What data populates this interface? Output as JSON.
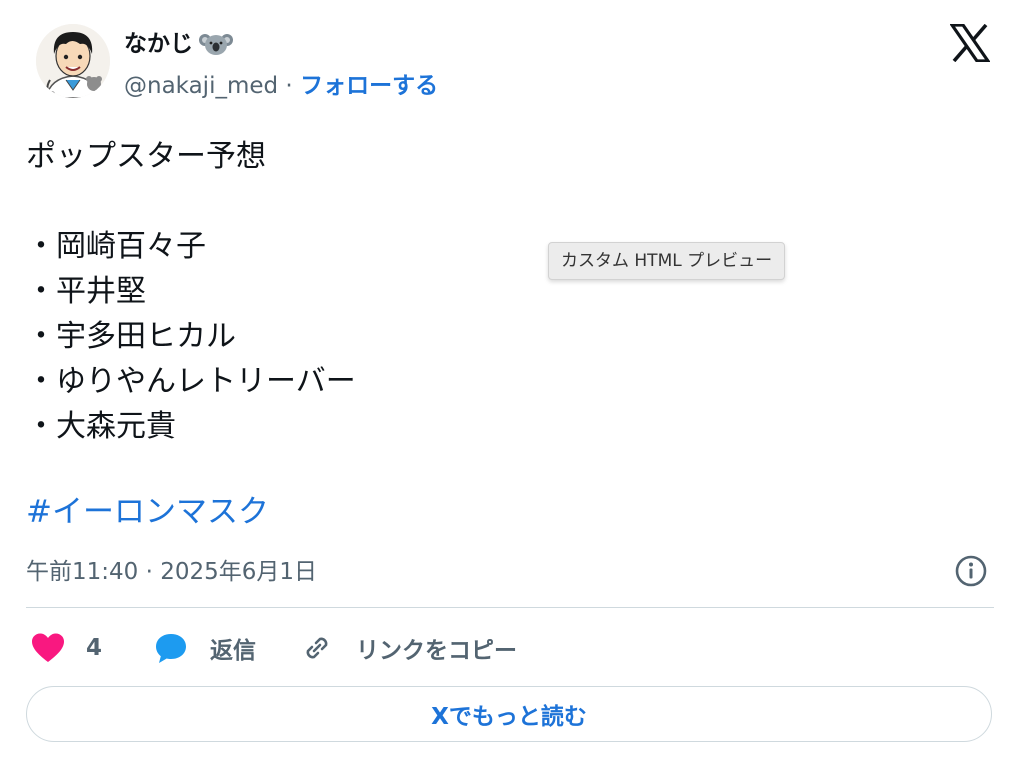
{
  "author": {
    "display_name": "なかじ",
    "badge_icon": "koala-emoji-icon",
    "handle": "@nakaji_med",
    "separator": " · ",
    "follow_label": "フォローする"
  },
  "brand_logo": "x-logo-icon",
  "tweet": {
    "lines": [
      "ポップスター予想",
      "",
      "・岡崎百々子",
      "・平井堅",
      "・宇多田ヒカル",
      "・ゆりやんレトリーバー",
      "・大森元貴"
    ],
    "hashtag": "#イーロンマスク"
  },
  "tooltip": "カスタム HTML プレビュー",
  "meta": {
    "timestamp": "午前11:40 · 2025年6月1日"
  },
  "actions": {
    "like_count": "4",
    "reply_label": "返信",
    "copy_link_label": "リンクをコピー"
  },
  "read_more_label": "Xでもっと読む",
  "colors": {
    "accent": "#1d73d8",
    "like": "#f91880",
    "reply": "#1d9bf0",
    "secondary_text": "#536471"
  }
}
